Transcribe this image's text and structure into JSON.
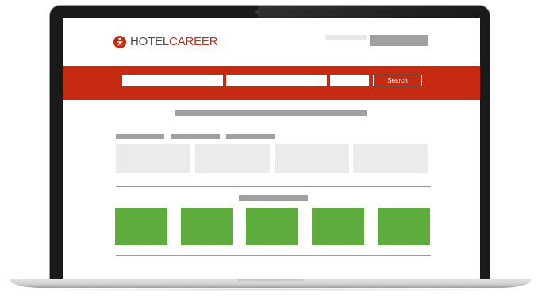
{
  "brand": {
    "name_part1": "HOTEL",
    "name_part2": "CAREER",
    "logo_icon": "hotel-career-logo-icon",
    "accent_color": "#c62a10"
  },
  "search": {
    "button_label": "Search"
  },
  "colors": {
    "band": "#c62a10",
    "placeholder_bar": "#a0a0a0",
    "tile": "#eceaec",
    "green_tile": "#5eab3e"
  }
}
